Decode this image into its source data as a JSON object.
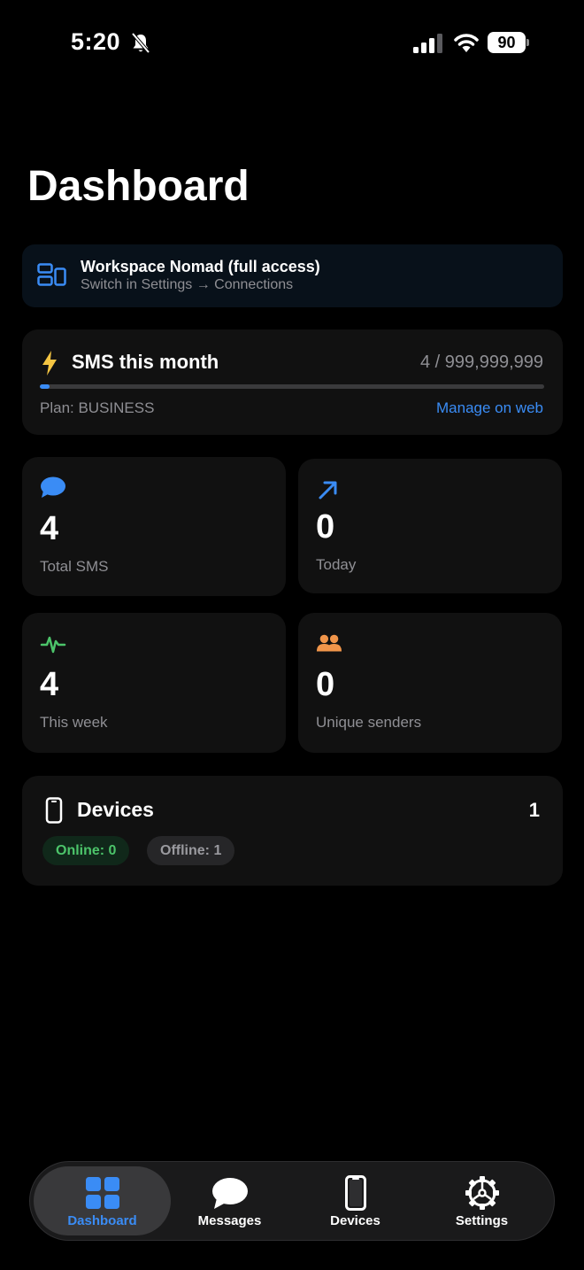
{
  "status_bar": {
    "time": "5:20",
    "battery": "90",
    "icons": [
      "bell-slash-icon",
      "cellular-signal-icon",
      "wifi-icon",
      "battery-icon"
    ]
  },
  "page": {
    "title": "Dashboard"
  },
  "workspace": {
    "title": "Workspace Nomad (full access)",
    "subtitle": "Switch in Settings → Connections",
    "icon": "workspace-switch-icon"
  },
  "sms_usage": {
    "title": "SMS this month",
    "count": "4 / 999,999,999",
    "used": 4,
    "limit": 999999999,
    "plan": "Plan: BUSINESS",
    "manage_label": "Manage on web",
    "icon": "lightning-bolt-icon"
  },
  "stats": [
    {
      "value": "4",
      "label": "Total SMS",
      "icon": "chat-bubble-icon",
      "color": "#3a8cf5"
    },
    {
      "value": "0",
      "label": "Today",
      "icon": "arrow-up-right-icon",
      "color": "#3a8cf5"
    },
    {
      "value": "4",
      "label": "This week",
      "icon": "pulse-icon",
      "color": "#4cc46a"
    },
    {
      "value": "0",
      "label": "Unique senders",
      "icon": "people-icon",
      "color": "#f0954a"
    }
  ],
  "devices": {
    "title": "Devices",
    "count": "1",
    "online": "Online: 0",
    "offline": "Offline: 1",
    "icon": "smartphone-icon"
  },
  "tabbar": {
    "active": "Dashboard",
    "tabs": [
      {
        "label": "Dashboard",
        "icon": "grid-icon"
      },
      {
        "label": "Messages",
        "icon": "message-bubble-icon"
      },
      {
        "label": "Devices",
        "icon": "smartphone-icon"
      },
      {
        "label": "Settings",
        "icon": "gear-icon"
      }
    ]
  },
  "colors": {
    "accent": "#3a8cf5",
    "online": "#4cc46a",
    "warning": "#f5c542",
    "senders": "#f0954a",
    "background": "#000000",
    "card": "#111111"
  }
}
